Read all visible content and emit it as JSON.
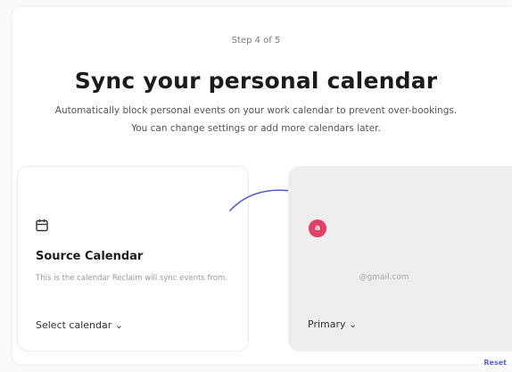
{
  "header": {
    "step": "Step 4 of 5",
    "title": "Sync your personal calendar",
    "subtitle": "Automatically block personal events on your work calendar to prevent over-bookings. You can change settings or add more calendars later."
  },
  "source_card": {
    "icon": "calendar-icon",
    "title": "Source Calendar",
    "description": "This is the calendar Reclaim will sync events from.",
    "select_label": "Select calendar ⌄"
  },
  "destination_card": {
    "avatar_letter": "a",
    "avatar_color": "#e23e6a",
    "email": "@gmail.com",
    "select_label": "Primary ⌄"
  },
  "footer": {
    "reset_label": "Reset"
  },
  "colors": {
    "arrow": "#4a5bd4",
    "accent": "#5a67d8"
  }
}
